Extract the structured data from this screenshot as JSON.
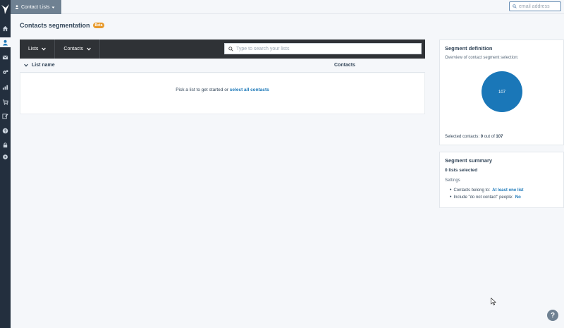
{
  "topbar": {
    "menu_label": "Contact Lists",
    "email_placeholder": "email address"
  },
  "sidebar": {
    "items": [
      {
        "icon": "home-icon"
      },
      {
        "icon": "contacts-icon",
        "active": true
      },
      {
        "icon": "mail-icon"
      },
      {
        "icon": "settings-icon"
      },
      {
        "icon": "reports-icon"
      },
      {
        "icon": "cart-icon"
      },
      {
        "icon": "edit-icon"
      },
      {
        "icon": "help-icon"
      },
      {
        "icon": "lock-icon"
      },
      {
        "icon": "circle-icon"
      }
    ]
  },
  "page": {
    "title": "Contacts segmentation",
    "badge": "Beta"
  },
  "toolbar": {
    "tabs": [
      {
        "label": "Lists"
      },
      {
        "label": "Contacts"
      }
    ],
    "search_placeholder": "Type to search your lists"
  },
  "table": {
    "columns": [
      "List name",
      "Contacts"
    ],
    "empty_message": "Pick a list to get started or",
    "empty_link": "select all contacts"
  },
  "segment_definition": {
    "title": "Segment definition",
    "subtitle": "Overview of contact segment selection:",
    "pie_value": "107",
    "pie_color": "#1a77b8",
    "selected_prefix": "Selected contacts:",
    "selected_count": "0",
    "selected_mid": "out of",
    "selected_total": "107"
  },
  "segment_summary": {
    "title": "Segment summary",
    "lists_selected": "0 lists selected",
    "settings_label": "Settings",
    "items": [
      {
        "label": "Contacts belong to:",
        "value": "At least one list"
      },
      {
        "label": "Include \"do not contact\" people:",
        "value": "No"
      }
    ]
  },
  "help_button": "?"
}
